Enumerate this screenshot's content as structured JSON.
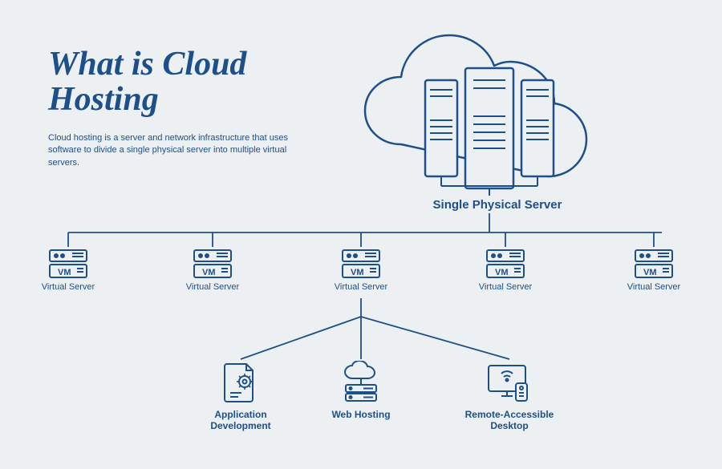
{
  "title_line1": "What is Cloud",
  "title_line2": "Hosting",
  "subtitle": "Cloud hosting is a server and network infrastructure that uses software to divide a single physical server into multiple virtual servers.",
  "physical_label": "Single Physical Server",
  "vms": [
    {
      "label": "Virtual Server"
    },
    {
      "label": "Virtual Server"
    },
    {
      "label": "Virtual Server"
    },
    {
      "label": "Virtual Server"
    },
    {
      "label": "Virtual Server"
    }
  ],
  "uses": [
    {
      "label": "Application\nDevelopment"
    },
    {
      "label": "Web Hosting"
    },
    {
      "label": "Remote-Accessible\nDesktop"
    }
  ],
  "colors": {
    "primary": "#1d4f8b",
    "bg": "#edf0f3"
  }
}
